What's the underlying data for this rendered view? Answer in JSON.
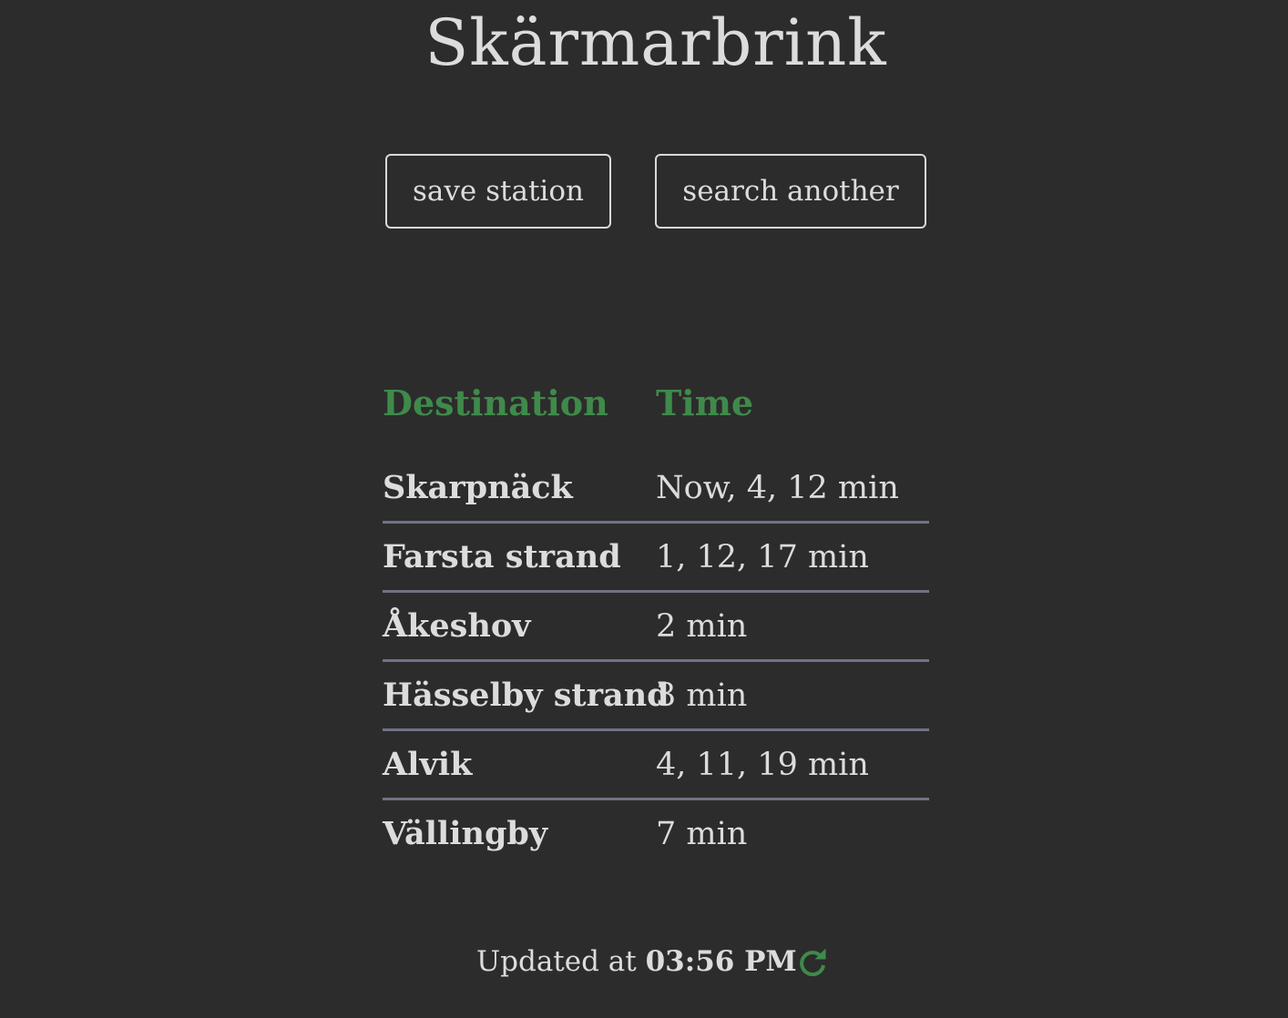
{
  "station": {
    "name": "Skärmarbrink"
  },
  "actions": {
    "save_label": "save station",
    "search_label": "search another"
  },
  "table": {
    "headers": {
      "destination": "Destination",
      "time": "Time"
    },
    "rows": [
      {
        "destination": "Skarpnäck",
        "time": "Now, 4, 12 min"
      },
      {
        "destination": "Farsta strand",
        "time": "1, 12, 17 min"
      },
      {
        "destination": "Åkeshov",
        "time": "2 min"
      },
      {
        "destination": "Hässelby strand",
        "time": "3 min"
      },
      {
        "destination": "Alvik",
        "time": "4, 11, 19 min"
      },
      {
        "destination": "Vällingby",
        "time": "7 min"
      }
    ]
  },
  "footer": {
    "updated_prefix": "Updated at",
    "updated_time": "03:56 PM",
    "refresh_icon": "refresh-icon"
  },
  "colors": {
    "background": "#2c2c2c",
    "accent": "#3f8a4a",
    "text": "#dcdcdc",
    "divider": "#6f7384"
  }
}
